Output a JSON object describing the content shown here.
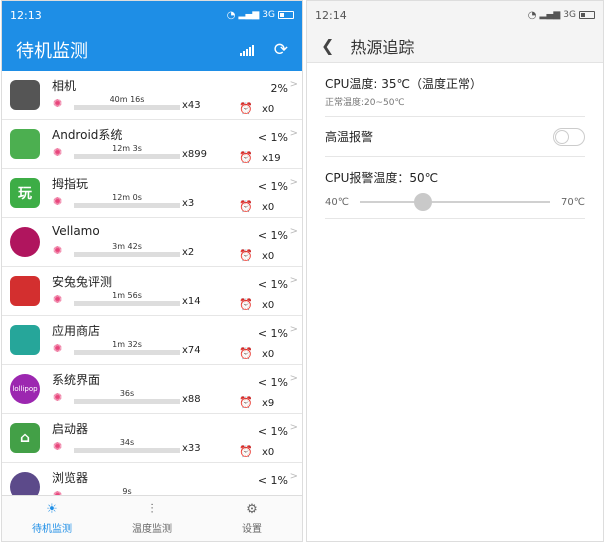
{
  "left": {
    "status": {
      "time": "12:13",
      "network": "3G"
    },
    "title": "待机监测",
    "apps": [
      {
        "name": "相机",
        "pct": "2%",
        "time": "40m 16s",
        "wakes": "x43",
        "alarms": "x0",
        "icon": "camera-icon",
        "icon_text": "",
        "color": "#555555",
        "progress": 0.02
      },
      {
        "name": "Android系统",
        "pct": "< 1%",
        "time": "12m 3s",
        "wakes": "x899",
        "alarms": "x19",
        "icon": "android-system-icon",
        "icon_text": "",
        "color": "#4caf50",
        "progress": 0.01
      },
      {
        "name": "拇指玩",
        "pct": "< 1%",
        "time": "12m 0s",
        "wakes": "x3",
        "alarms": "x0",
        "icon": "muzhiwan-icon",
        "icon_text": "玩",
        "color": "#3dad46",
        "progress": 0.01
      },
      {
        "name": "Vellamo",
        "pct": "< 1%",
        "time": "3m 42s",
        "wakes": "x2",
        "alarms": "x0",
        "icon": "vellamo-icon",
        "icon_text": "",
        "color": "#b0155e",
        "progress": 0.01
      },
      {
        "name": "安兔兔评测",
        "pct": "< 1%",
        "time": "1m 56s",
        "wakes": "x14",
        "alarms": "x0",
        "icon": "antutu-icon",
        "icon_text": "",
        "color": "#d32f2f",
        "progress": 0.01
      },
      {
        "name": "应用商店",
        "pct": "< 1%",
        "time": "1m 32s",
        "wakes": "x74",
        "alarms": "x0",
        "icon": "app-store-icon",
        "icon_text": "",
        "color": "#26a69a",
        "progress": 0.01
      },
      {
        "name": "系统界面",
        "pct": "< 1%",
        "time": "36s",
        "wakes": "x88",
        "alarms": "x9",
        "icon": "lollipop-icon",
        "icon_text": "lollipop",
        "color": "#9c27b0",
        "progress": 0.01
      },
      {
        "name": "启动器",
        "pct": "< 1%",
        "time": "34s",
        "wakes": "x33",
        "alarms": "x0",
        "icon": "launcher-icon",
        "icon_text": "⌂",
        "color": "#43a047",
        "progress": 0.01
      },
      {
        "name": "浏览器",
        "pct": "< 1%",
        "time": "9s",
        "wakes": "",
        "alarms": "",
        "icon": "browser-icon",
        "icon_text": "",
        "color": "#5c4a8a",
        "progress": 0.01
      }
    ],
    "tabs": [
      {
        "label": "待机监测",
        "icon": "bulb-icon",
        "active": true
      },
      {
        "label": "温度监测",
        "icon": "thermometer-icon",
        "active": false
      },
      {
        "label": "设置",
        "icon": "gear-icon",
        "active": false
      }
    ]
  },
  "right": {
    "status": {
      "time": "12:14",
      "network": "3G"
    },
    "title": "热源追踪",
    "cpu_temp": "CPU温度: 35℃（温度正常）",
    "normal_range": "正常温度:20~50℃",
    "alarm_label": "高温报警",
    "alarm_enabled": false,
    "threshold_label": "CPU报警温度：50℃",
    "slider_min": "40℃",
    "slider_max": "70℃",
    "slider_value": 50,
    "slider_min_value": 40,
    "slider_max_value": 70
  },
  "colors": {
    "accent": "#1e8ee6",
    "wake_icon": "#e8467c",
    "progress": "#2aa84a"
  }
}
